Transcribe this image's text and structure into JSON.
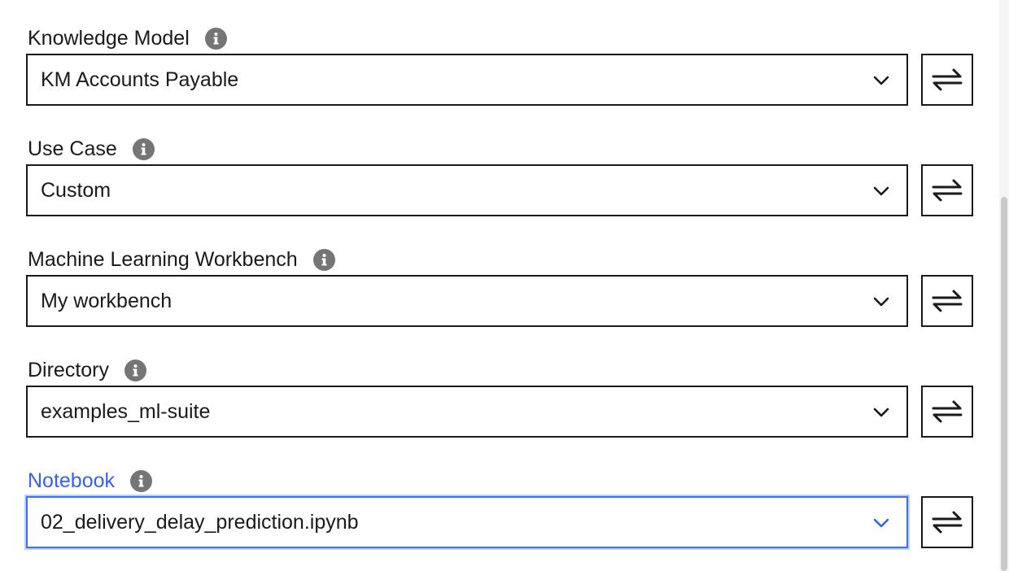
{
  "fields": [
    {
      "label": "Knowledge Model",
      "value": "KM Accounts Payable",
      "info_icon": "info-icon",
      "dropdown_icon": "chevron-down-icon",
      "swap_icon": "swap-arrows-icon",
      "active": false
    },
    {
      "label": "Use Case",
      "value": "Custom",
      "info_icon": "info-icon",
      "dropdown_icon": "chevron-down-icon",
      "swap_icon": "swap-arrows-icon",
      "active": false
    },
    {
      "label": "Machine Learning Workbench",
      "value": "My workbench",
      "info_icon": "info-icon",
      "dropdown_icon": "chevron-down-icon",
      "swap_icon": "swap-arrows-icon",
      "active": false
    },
    {
      "label": "Directory",
      "value": "examples_ml-suite",
      "info_icon": "info-icon",
      "dropdown_icon": "chevron-down-icon",
      "swap_icon": "swap-arrows-icon",
      "active": false
    },
    {
      "label": "Notebook",
      "value": "02_delivery_delay_prediction.ipynb",
      "info_icon": "info-icon",
      "dropdown_icon": "chevron-down-icon",
      "swap_icon": "swap-arrows-icon",
      "active": true
    }
  ],
  "colors": {
    "text": "#1a1a1a",
    "active_label": "#3463e6",
    "active_border": "#3f6ff0",
    "focus_ring": "#bcd0ff",
    "info_icon_bg": "#757575",
    "scrollbar_thumb": "#c9c9c9"
  }
}
